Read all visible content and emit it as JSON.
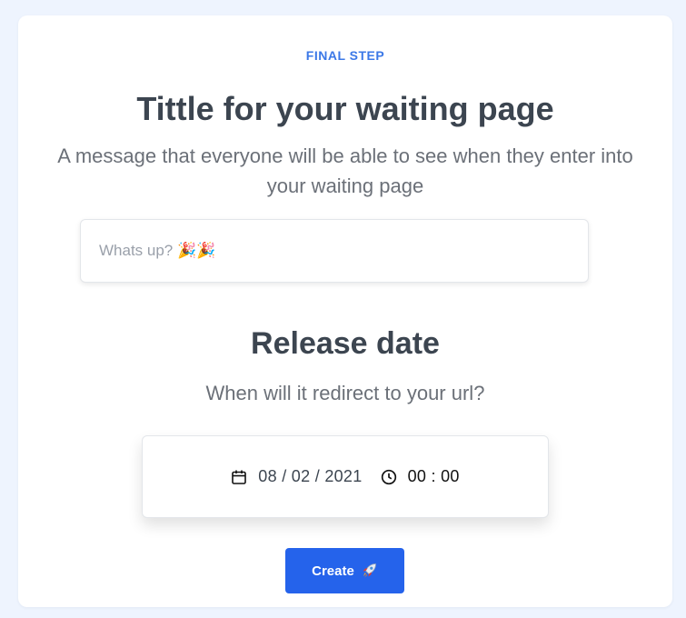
{
  "header": {
    "eyebrow": "FINAL STEP",
    "title": "Tittle for your waiting page",
    "subtitle": "A message that everyone will be able to see when they enter into your waiting page"
  },
  "message_input": {
    "placeholder": "Whats up? 🎉🎉",
    "value": ""
  },
  "release": {
    "title": "Release date",
    "subtitle": "When will it redirect to your url?",
    "date_value": "08 / 02 / 2021",
    "time_value": "00 : 00",
    "date_icon": "calendar-icon",
    "time_icon": "clock-icon"
  },
  "actions": {
    "create_label": "Create",
    "create_icon": "rocket-icon"
  },
  "colors": {
    "accent": "#2563eb",
    "eyebrow": "#3b78e7",
    "heading": "#3c4550",
    "background": "#eef4fe"
  }
}
